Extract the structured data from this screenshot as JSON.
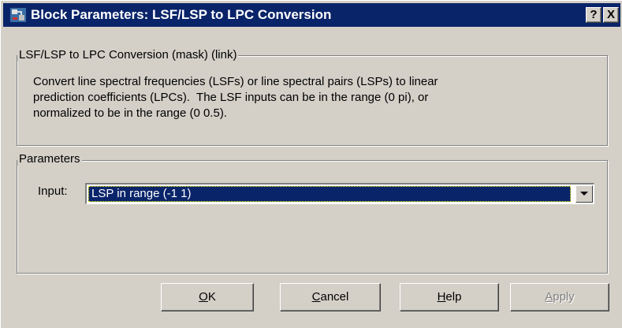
{
  "window": {
    "title": "Block Parameters: LSF/LSP to LPC Conversion",
    "help_glyph": "?",
    "close_glyph": "X",
    "icon": "simulink-block-icon"
  },
  "mask_group": {
    "legend": "LSF/LSP to LPC Conversion (mask) (link)",
    "description": "Convert line spectral frequencies (LSFs) or line spectral pairs (LSPs) to linear\nprediction coefficients (LPCs).  The LSF inputs can be in the range (0 pi), or\nnormalized to be in the range (0 0.5)."
  },
  "parameters_group": {
    "legend": "Parameters",
    "input_label": "Input:",
    "input_value": "LSP in range (-1 1)"
  },
  "buttons": {
    "ok": {
      "accel": "O",
      "rest": "K"
    },
    "cancel": {
      "accel": "C",
      "rest": "ancel"
    },
    "help": {
      "accel": "H",
      "rest": "elp"
    },
    "apply": {
      "accel": "A",
      "rest": "pply",
      "enabled": false
    }
  },
  "colors": {
    "titlebar": "#0a246a",
    "face": "#d4d0c8",
    "selection": "#0a246a"
  }
}
